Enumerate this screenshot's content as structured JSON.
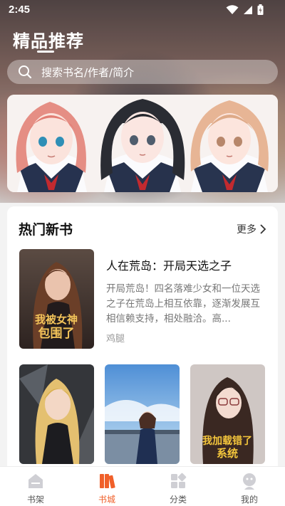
{
  "status_bar": {
    "time": "2:45"
  },
  "header": {
    "title": "精品推荐",
    "search_placeholder": "搜索书名/作者/简介"
  },
  "section": {
    "title": "热门新书",
    "more_label": "更多"
  },
  "featured_book": {
    "title": "人在荒岛：开局天选之子",
    "description": "开局荒岛！四名落难少女和一位天选之子在荒岛上相互依靠，逐渐发展互相信赖支持，相处融洽。高...",
    "author": "鸡腿",
    "cover_text": "我被女神包围了"
  },
  "grid_books": [
    {
      "cover_text": ""
    },
    {
      "cover_text": ""
    },
    {
      "cover_text": "我加载错了系统"
    }
  ],
  "bottom_nav": [
    {
      "label": "书架",
      "icon": "bookshelf-icon",
      "active": false
    },
    {
      "label": "书城",
      "icon": "bookstore-icon",
      "active": true
    },
    {
      "label": "分类",
      "icon": "category-icon",
      "active": false
    },
    {
      "label": "我的",
      "icon": "profile-icon",
      "active": false
    }
  ],
  "colors": {
    "accent": "#f0602a"
  }
}
